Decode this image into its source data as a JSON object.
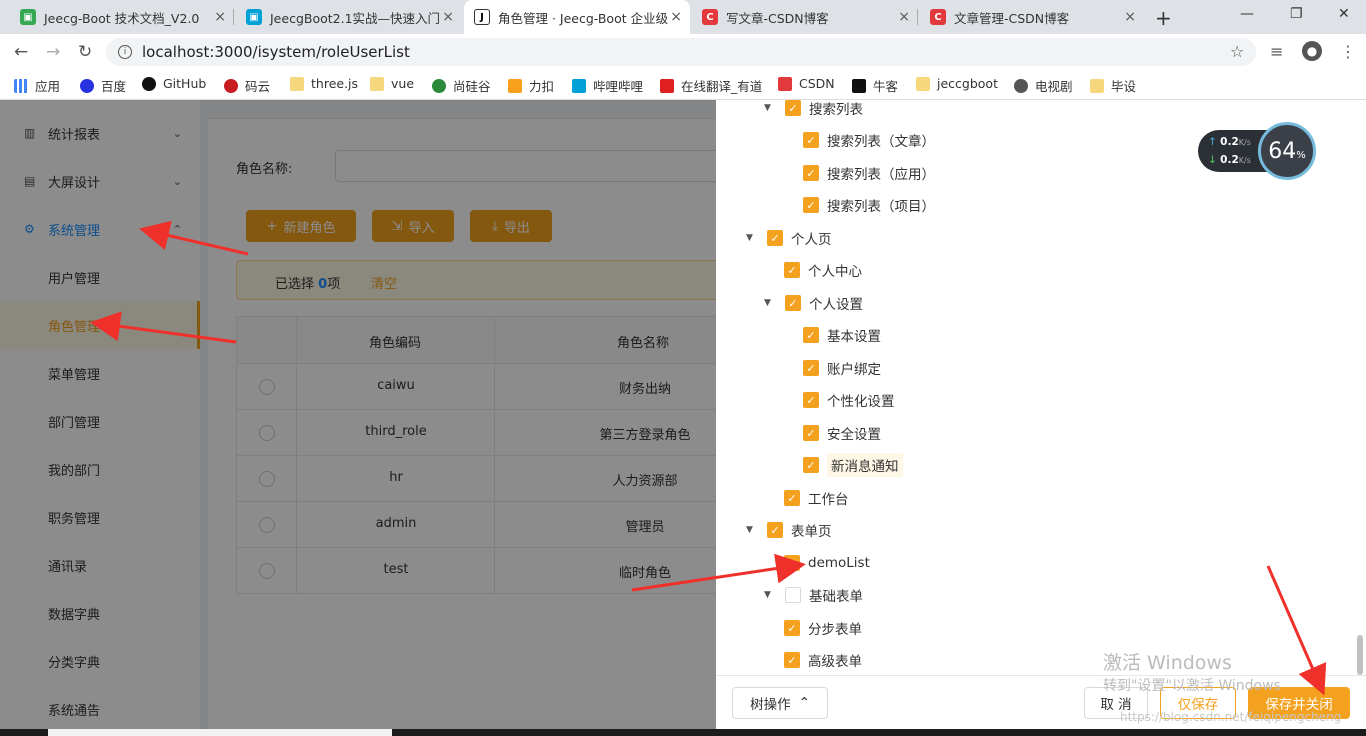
{
  "browser": {
    "tabs": [
      {
        "title": "Jeecg-Boot 技术文档_V2.0",
        "color": "#35a853",
        "glyph": "▣"
      },
      {
        "title": "JeecgBoot2.1实战—快速入门",
        "color": "#00a1d6",
        "glyph": "▣"
      },
      {
        "title": "角色管理 · Jeecg-Boot 企业级",
        "color": "#333333",
        "glyph": "J"
      },
      {
        "title": "写文章-CSDN博客",
        "color": "#e4393c",
        "glyph": "C"
      },
      {
        "title": "文章管理-CSDN博客",
        "color": "#e4393c",
        "glyph": "C"
      }
    ],
    "url": "localhost:3000/isystem/roleUserList",
    "bookmarks": [
      "应用",
      "百度",
      "GitHub",
      "码云",
      "three.js",
      "vue",
      "尚硅谷",
      "力扣",
      "哔哩哔哩",
      "在线翻译_有道",
      "CSDN",
      "牛客",
      "jeccgboot",
      "电视剧",
      "毕设"
    ]
  },
  "sidebar": {
    "groups": [
      "统计报表",
      "大屏设计",
      "系统管理"
    ],
    "items": [
      "用户管理",
      "角色管理",
      "菜单管理",
      "部门管理",
      "我的部门",
      "职务管理",
      "通讯录",
      "数据字典",
      "分类字典",
      "系统通告"
    ]
  },
  "main": {
    "search_label": "角色名称:",
    "buttons": {
      "add": "新建角色",
      "import": "导入",
      "export": "导出"
    },
    "selection": {
      "prefix": "已选择",
      "count": "0",
      "suffix": "项",
      "clear": "清空"
    },
    "table": {
      "headers": [
        "角色编码",
        "角色名称"
      ],
      "rows": [
        {
          "code": "caiwu",
          "name": "财务出纳"
        },
        {
          "code": "third_role",
          "name": "第三方登录角色"
        },
        {
          "code": "hr",
          "name": "人力资源部"
        },
        {
          "code": "admin",
          "name": "管理员"
        },
        {
          "code": "test",
          "name": "临时角色"
        }
      ]
    }
  },
  "tree": {
    "nodes": [
      {
        "label": "搜索列表",
        "checked": true,
        "toggle": true
      },
      {
        "label": "搜索列表（文章）",
        "checked": true
      },
      {
        "label": "搜索列表（应用）",
        "checked": true
      },
      {
        "label": "搜索列表（项目）",
        "checked": true
      },
      {
        "label": "个人页",
        "checked": true,
        "toggle": true
      },
      {
        "label": "个人中心",
        "checked": true
      },
      {
        "label": "个人设置",
        "checked": true,
        "toggle": true
      },
      {
        "label": "基本设置",
        "checked": true
      },
      {
        "label": "账户绑定",
        "checked": true
      },
      {
        "label": "个性化设置",
        "checked": true
      },
      {
        "label": "安全设置",
        "checked": true
      },
      {
        "label": "新消息通知",
        "checked": true,
        "highlight": true
      },
      {
        "label": "工作台",
        "checked": true
      },
      {
        "label": "表单页",
        "checked": true,
        "toggle": true
      },
      {
        "label": "demoList",
        "checked": true
      },
      {
        "label": "基础表单",
        "checked": false,
        "toggle": true
      },
      {
        "label": "分步表单",
        "checked": true
      },
      {
        "label": "高级表单",
        "checked": true
      }
    ]
  },
  "footer": {
    "tree_ops": "树操作",
    "cancel": "取 消",
    "save_only": "仅保存",
    "save_close": "保存并关闭"
  },
  "speed_widget": {
    "up": "0.2",
    "down": "0.2",
    "unit": "K/s",
    "percent": "64",
    "percent_sign": "%"
  },
  "watermark": {
    "line1": "激活 Windows",
    "line2": "转到\"设置\"以激活 Windows",
    "blog": "https://blog.csdn.net/feiqipengcheng"
  },
  "colors": {
    "accent": "#f3a11e",
    "link": "#1890ff",
    "arrow": "#f0302a"
  }
}
